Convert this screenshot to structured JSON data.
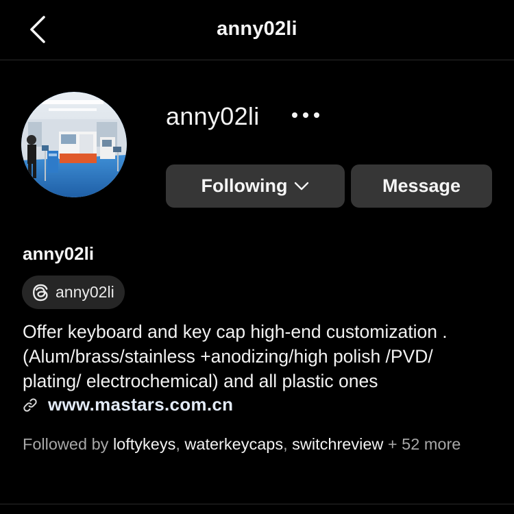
{
  "header": {
    "title": "anny02li",
    "back_icon": "chevron-left-icon"
  },
  "profile": {
    "username": "anny02li",
    "more_icon": "more-horizontal-icon",
    "avatar_description_icon": "avatar-image"
  },
  "actions": {
    "following_label": "Following",
    "following_icon": "chevron-down-icon",
    "message_label": "Message"
  },
  "bio": {
    "display_name": "anny02li",
    "threads_label": "anny02li",
    "threads_icon": "threads-icon",
    "lines": [
      "Offer keyboard and key cap high-end customization .",
      "(Alum/brass/stainless +anodizing/high polish /PVD/",
      "plating/ electrochemical) and all plastic ones"
    ],
    "link_icon": "link-icon",
    "link_text": "www.mastars.com.cn"
  },
  "followed_by": {
    "prefix": "Followed by ",
    "accounts": [
      "loftykeys",
      "waterkeycaps",
      "switchreview"
    ],
    "separator": ", ",
    "suffix": " + 52 more"
  },
  "colors": {
    "background": "#000000",
    "button_bg": "#363636",
    "badge_bg": "#262626",
    "text_primary": "#f5f5f5",
    "text_secondary": "#a8a8a8",
    "link_text": "#e3ebf7"
  }
}
